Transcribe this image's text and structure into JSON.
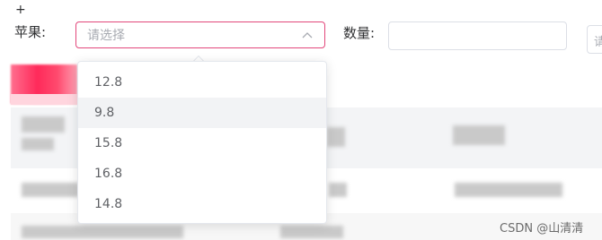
{
  "form": {
    "plus_text": "+",
    "fruit_label": "苹果:",
    "select_placeholder": "请选择",
    "qty_label": "数量:",
    "qty_value": "",
    "partial_input_placeholder": "请"
  },
  "dropdown": {
    "options": [
      "12.8",
      "9.8",
      "15.8",
      "16.8",
      "14.8"
    ],
    "hovered_index": 1
  },
  "watermark": "CSDN @山清清",
  "colors": {
    "select_border": "#e2477b",
    "hover_bg": "#f2f3f5",
    "placeholder": "#a8abb2"
  }
}
